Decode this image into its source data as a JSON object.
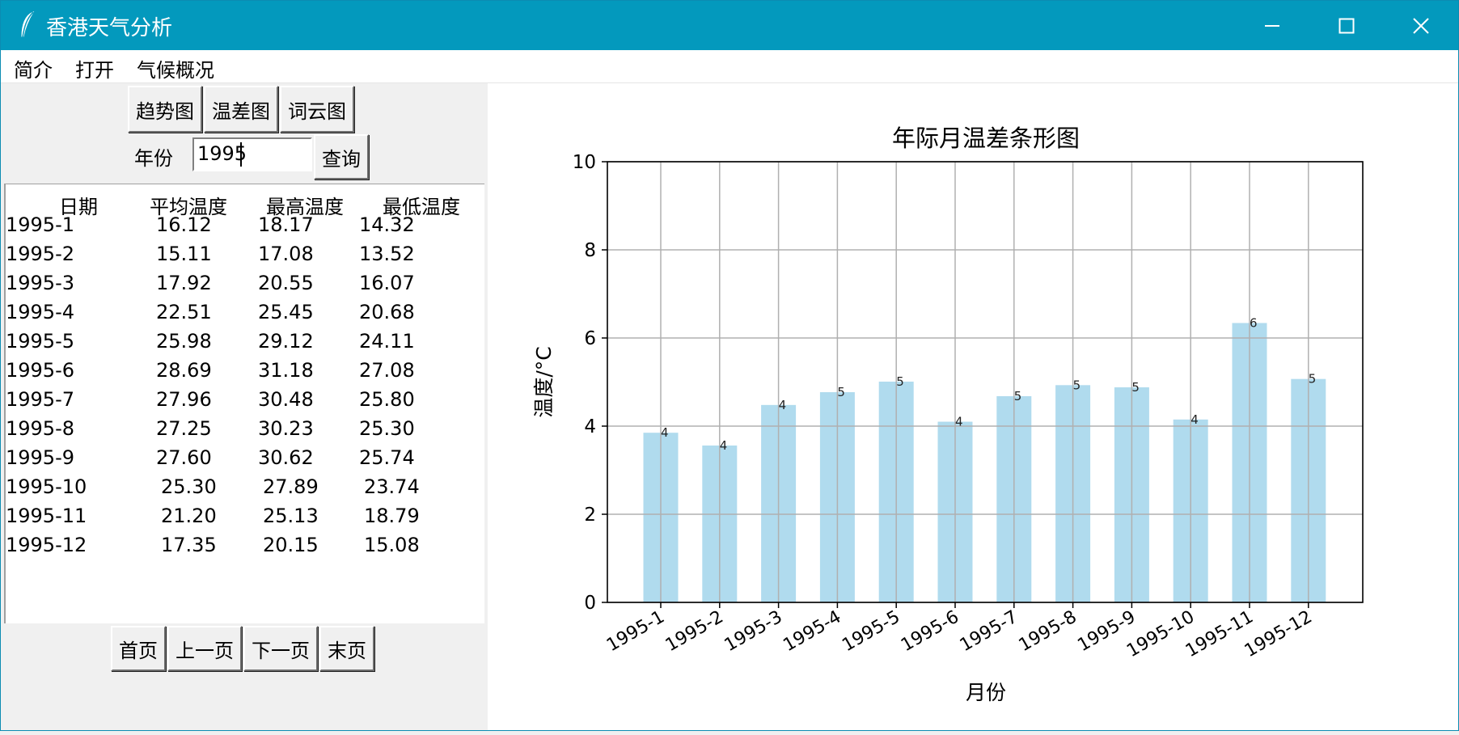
{
  "window": {
    "title": "香港天气分析",
    "icon": "feather-icon",
    "controls": [
      "minimize-icon",
      "maximize-icon",
      "close-icon"
    ]
  },
  "menu": [
    "简介",
    "打开",
    "气候概况"
  ],
  "toolbar": {
    "buttons": [
      "趋势图",
      "温差图",
      "词云图"
    ]
  },
  "query": {
    "label": "年份",
    "value": "1995",
    "button": "查询"
  },
  "table": {
    "headers": [
      "日期",
      "平均温度",
      "最高温度",
      "最低温度"
    ],
    "rows": [
      [
        "1995-1",
        "16.12",
        "18.17",
        "14.32"
      ],
      [
        "1995-2",
        "15.11",
        "17.08",
        "13.52"
      ],
      [
        "1995-3",
        "17.92",
        "20.55",
        "16.07"
      ],
      [
        "1995-4",
        "22.51",
        "25.45",
        "20.68"
      ],
      [
        "1995-5",
        "25.98",
        "29.12",
        "24.11"
      ],
      [
        "1995-6",
        "28.69",
        "31.18",
        "27.08"
      ],
      [
        "1995-7",
        "27.96",
        "30.48",
        "25.80"
      ],
      [
        "1995-8",
        "27.25",
        "30.23",
        "25.30"
      ],
      [
        "1995-9",
        "27.60",
        "30.62",
        "25.74"
      ],
      [
        "1995-10",
        "25.30",
        "27.89",
        "23.74"
      ],
      [
        "1995-11",
        "21.20",
        "25.13",
        "18.79"
      ],
      [
        "1995-12",
        "17.35",
        "20.15",
        "15.08"
      ]
    ]
  },
  "pagination": [
    "首页",
    "上一页",
    "下一页",
    "末页"
  ],
  "chart_data": {
    "type": "bar",
    "title": "年际月温差条形图",
    "xlabel": "月份",
    "ylabel": "温度/°C",
    "categories": [
      "1995-1",
      "1995-2",
      "1995-3",
      "1995-4",
      "1995-5",
      "1995-6",
      "1995-7",
      "1995-8",
      "1995-9",
      "1995-10",
      "1995-11",
      "1995-12"
    ],
    "values": [
      3.85,
      3.56,
      4.48,
      4.77,
      5.01,
      4.1,
      4.68,
      4.93,
      4.88,
      4.15,
      6.34,
      5.07
    ],
    "data_labels": [
      "4",
      "4",
      "4",
      "5",
      "5",
      "4",
      "5",
      "5",
      "5",
      "4",
      "6",
      "5"
    ],
    "ylim": [
      0,
      10
    ],
    "yticks": [
      "0",
      "2",
      "4",
      "6",
      "8",
      "10"
    ],
    "grid": true,
    "bar_color": "#b0dbee"
  }
}
